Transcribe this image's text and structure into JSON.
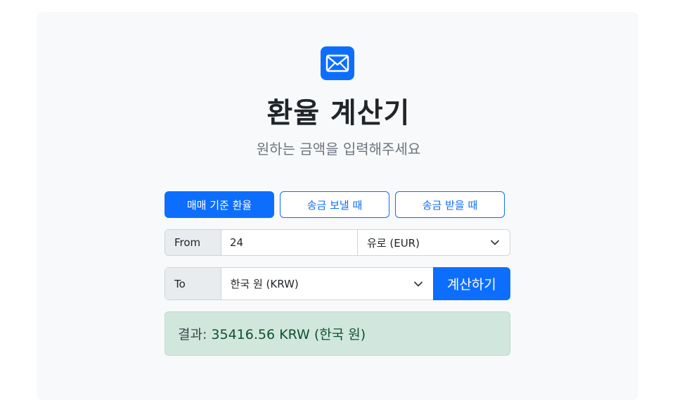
{
  "header": {
    "logo_icon": "envelope-icon",
    "title": "환율 계산기",
    "subtitle": "원하는 금액을 입력해주세요"
  },
  "modes": [
    {
      "label": "매매 기준 환율",
      "active": true
    },
    {
      "label": "송금 보낼 때",
      "active": false
    },
    {
      "label": "송금 받을 때",
      "active": false
    }
  ],
  "from": {
    "label": "From",
    "amount": "24",
    "currency": "유로 (EUR)"
  },
  "to": {
    "label": "To",
    "currency": "한국 원 (KRW)",
    "calculate_label": "계산하기"
  },
  "result": {
    "label": "결과:",
    "value": "35416.56 KRW (한국 원)"
  },
  "colors": {
    "accent": "#0d6efd",
    "result_bg": "#d1e7dd",
    "card_bg": "#f8f9fa"
  }
}
